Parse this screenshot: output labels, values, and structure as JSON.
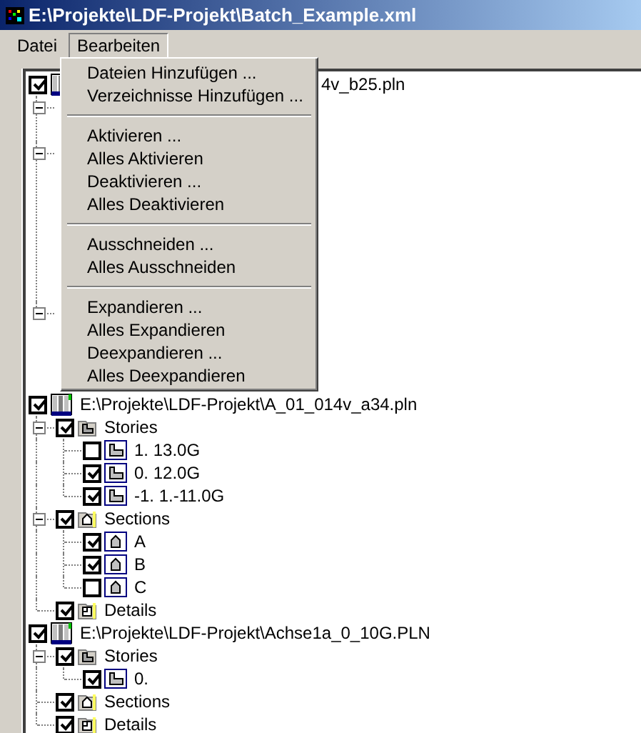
{
  "window": {
    "title": "E:\\Projekte\\LDF-Projekt\\Batch_Example.xml"
  },
  "menu_bar": [
    {
      "label": "Datei",
      "selected": false
    },
    {
      "label": "Bearbeiten",
      "selected": true
    }
  ],
  "open_menu": {
    "groups": [
      {
        "items": [
          "Dateien Hinzufügen ...",
          "Verzeichnisse Hinzufügen ..."
        ]
      },
      {
        "items": [
          "Aktivieren ...",
          "Alles Aktivieren",
          "Deaktivieren ...",
          "Alles Deaktivieren"
        ]
      },
      {
        "items": [
          "Ausschneiden ...",
          "Alles Ausschneiden"
        ]
      },
      {
        "items": [
          "Expandieren ...",
          "Alles Expandieren",
          "Deexpandieren ...",
          "Alles Deexpandieren"
        ]
      }
    ]
  },
  "tree": [
    {
      "label": "4v_b25.pln",
      "kind": "file",
      "checked": true,
      "children": [
        {
          "kind": "obscured",
          "expanded": true
        },
        {
          "kind": "obscured",
          "expanded": true
        },
        {
          "kind": "obscured",
          "expanded": true
        }
      ]
    },
    {
      "label": "E:\\Projekte\\LDF-Projekt\\A_01_014v_a34.pln",
      "kind": "file",
      "checked": true,
      "children": [
        {
          "label": "Stories",
          "kind": "stories",
          "checked": true,
          "expanded": true,
          "children": [
            {
              "label": "1. 13.0G",
              "kind": "story",
              "checked": false
            },
            {
              "label": "0. 12.0G",
              "kind": "story",
              "checked": true
            },
            {
              "label": "-1. 1.-11.0G",
              "kind": "story",
              "checked": true
            }
          ]
        },
        {
          "label": "Sections",
          "kind": "sections",
          "checked": true,
          "expanded": true,
          "children": [
            {
              "label": "A",
              "kind": "section",
              "checked": true
            },
            {
              "label": "B",
              "kind": "section",
              "checked": true
            },
            {
              "label": "C",
              "kind": "section",
              "checked": false
            }
          ]
        },
        {
          "label": "Details",
          "kind": "details",
          "checked": true
        }
      ]
    },
    {
      "label": "E:\\Projekte\\LDF-Projekt\\Achse1a_0_10G.PLN",
      "kind": "file",
      "checked": true,
      "children": [
        {
          "label": "Stories",
          "kind": "stories",
          "checked": true,
          "expanded": true,
          "children": [
            {
              "label": "0.",
              "kind": "story",
              "checked": true
            }
          ]
        },
        {
          "label": "Sections",
          "kind": "sections",
          "checked": true
        },
        {
          "label": "Details",
          "kind": "details",
          "checked": true
        }
      ]
    }
  ]
}
